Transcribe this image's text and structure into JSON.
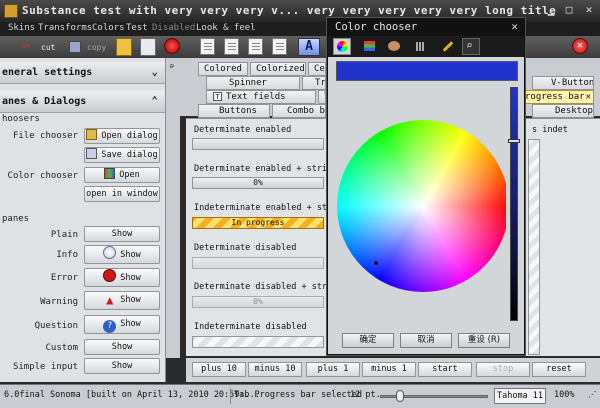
{
  "window": {
    "title": "Substance test with very very very v... very very very very very long title"
  },
  "menu": [
    "Skins",
    "Transforms",
    "Colors",
    "Test",
    "Disabled",
    "Look & feel"
  ],
  "toolbar": {
    "cut_label": "cut",
    "copy_label": "copy"
  },
  "left_panel": {
    "general_settings": "eneral settings",
    "panes_dialogs": "anes & Dialogs",
    "choosers_group": "hoosers",
    "panes_group": "panes",
    "rows": [
      {
        "label": "File chooser",
        "button": "Open dialog"
      },
      {
        "label": "",
        "button": "Save dialog"
      },
      {
        "label": "Color chooser",
        "button": "Open"
      },
      {
        "label": "",
        "button": "open in window"
      }
    ],
    "pane_rows": [
      {
        "label": "Plain",
        "button": "Show"
      },
      {
        "label": "Info",
        "button": "Show"
      },
      {
        "label": "Error",
        "button": "Show"
      },
      {
        "label": "Warning",
        "button": "Show"
      },
      {
        "label": "Question",
        "button": "Show"
      },
      {
        "label": "Custom",
        "button": "Show"
      },
      {
        "label": "Simple input",
        "button": "Show"
      }
    ]
  },
  "tabs": {
    "row1": [
      "Colored",
      "Colorized",
      "Ce"
    ],
    "row2": [
      "Spinner",
      "Tr"
    ],
    "row3": [
      "Text fields",
      "T"
    ],
    "row4": [
      "Buttons",
      "Combo box"
    ],
    "right": [
      "V-Buttons",
      "rogress bar",
      "Desktop"
    ]
  },
  "progress": {
    "items": [
      {
        "label": "Determinate enabled",
        "text": "",
        "type": "det"
      },
      {
        "label": "Determinate enabled + string",
        "text": "0%",
        "type": "det"
      },
      {
        "label": "Indeterminate enabled + string",
        "text": "In progress",
        "type": "ind"
      },
      {
        "label": "Determinate disabled",
        "text": "",
        "type": "det"
      },
      {
        "label": "Determinate disabled + string",
        "text": "0%",
        "type": "det"
      },
      {
        "label": "Indeterminate disabled",
        "text": "",
        "type": "indd"
      }
    ],
    "right_label": "s indet"
  },
  "bottom_buttons": [
    "plus 10",
    "minus 10",
    "plus 1",
    "minus 1",
    "start",
    "stop",
    "reset"
  ],
  "status": {
    "text": "6.0final Sonoma [built on April 13, 2010 20:59:...",
    "tab": "Tab Progress bar selected",
    "font_size": "12 pt.",
    "font": "Tahoma 11",
    "zoom": "100%"
  },
  "color_chooser": {
    "title": "Color chooser",
    "ok": "确定",
    "cancel": "取消",
    "reset": "重设 (R)",
    "selected_color": "#2233cc"
  }
}
